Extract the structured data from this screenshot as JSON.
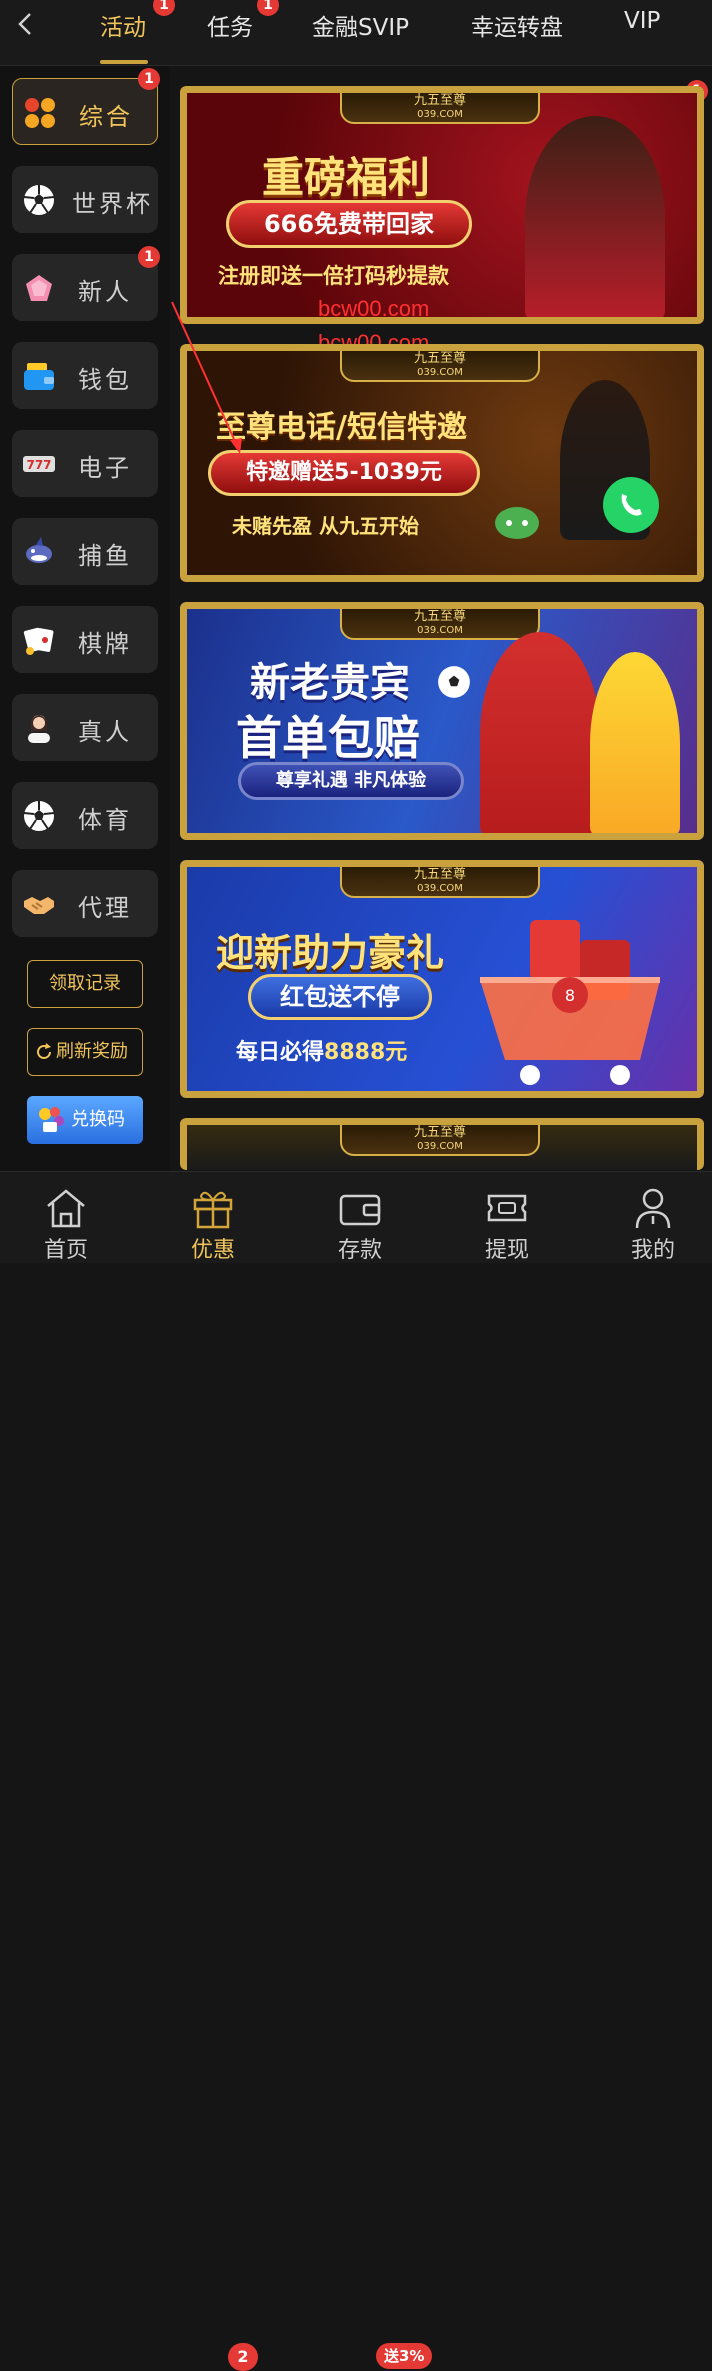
{
  "header": {
    "tabs": [
      {
        "label": "活动",
        "badge": "1",
        "active": true
      },
      {
        "label": "任务",
        "badge": "1"
      },
      {
        "label": "金融SVIP"
      },
      {
        "label": "幸运转盘"
      },
      {
        "label": "VIP"
      }
    ]
  },
  "sidebar": {
    "items": [
      {
        "label": "综合",
        "badge": "1",
        "icon": "grid-icon",
        "active": true
      },
      {
        "label": "世界杯",
        "icon": "soccer-ball-icon"
      },
      {
        "label": "新人",
        "badge": "1",
        "icon": "gem-icon"
      },
      {
        "label": "钱包",
        "icon": "wallet-icon"
      },
      {
        "label": "电子",
        "icon": "slot-777-icon"
      },
      {
        "label": "捕鱼",
        "icon": "shark-icon"
      },
      {
        "label": "棋牌",
        "icon": "cards-icon"
      },
      {
        "label": "真人",
        "icon": "live-dealer-icon"
      },
      {
        "label": "体育",
        "icon": "soccer-ball-icon"
      },
      {
        "label": "代理",
        "icon": "handshake-icon"
      }
    ],
    "records_label": "领取记录",
    "refresh_label": "刷新奖励",
    "redeem_label": "兑换码"
  },
  "banner_badge": "1",
  "brand": {
    "name": "九五至尊",
    "domain": "039.COM"
  },
  "banners": [
    {
      "title": "重磅福利",
      "pill": "666免费带回家",
      "subtitle": "注册即送一倍打码秒提款"
    },
    {
      "title": "至尊电话/短信特邀",
      "pill": "特邀赠送5-1039元",
      "subtitle": "未赌先盈 从九五开始"
    },
    {
      "title_line1": "新老贵宾",
      "title_line2": "首单包赔",
      "pill": "尊享礼遇 非凡体验"
    },
    {
      "title": "迎新助力豪礼",
      "pill": "红包送不停",
      "subtitle_prefix": "每日必得",
      "subtitle_amount": "8888元"
    }
  ],
  "watermarks": [
    "bcw00.com",
    "bcw00.com"
  ],
  "bottom_nav": [
    {
      "label": "首页",
      "icon": "home-icon"
    },
    {
      "label": "优惠",
      "icon": "gift-icon",
      "badge": "2",
      "active": true
    },
    {
      "label": "存款",
      "icon": "deposit-wallet-icon",
      "badge": "送3%"
    },
    {
      "label": "提现",
      "icon": "withdraw-ticket-icon"
    },
    {
      "label": "我的",
      "icon": "user-icon"
    }
  ],
  "colors": {
    "gold": "#c9a23e",
    "gold_text": "#f0c45a",
    "badge_red": "#e53935",
    "background": "#151515"
  }
}
